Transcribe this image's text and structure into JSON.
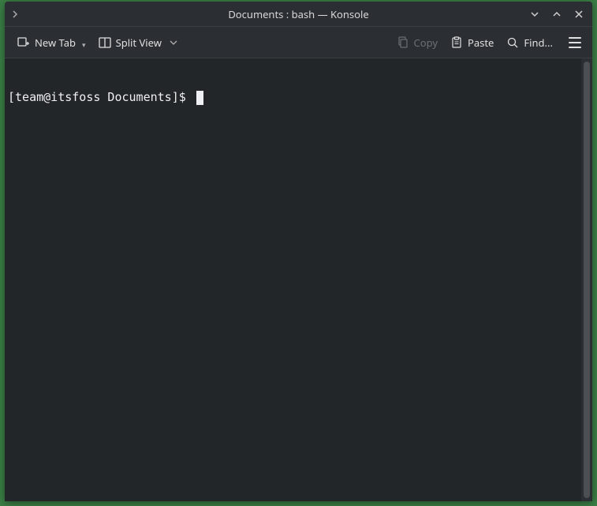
{
  "window": {
    "title": "Documents : bash — Konsole"
  },
  "toolbar": {
    "new_tab": "New Tab",
    "split_view": "Split View",
    "copy": "Copy",
    "paste": "Paste",
    "find": "Find..."
  },
  "terminal": {
    "prompt": "[team@itsfoss Documents]$ "
  }
}
